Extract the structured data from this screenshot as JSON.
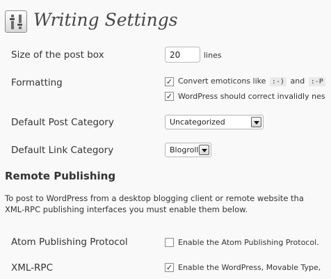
{
  "header": {
    "icon": "settings-sliders-icon",
    "title": "Writing Settings"
  },
  "post_box": {
    "label": "Size of the post box",
    "value": "20",
    "unit": "lines"
  },
  "formatting": {
    "label": "Formatting",
    "emoticons_prefix": "Convert emoticons like",
    "emoticon_1": ":-)",
    "and": "and",
    "emoticon_2": ":-P",
    "emoticons_checked": true,
    "xhtml_text": "WordPress should correct invalidly nes",
    "xhtml_checked": true
  },
  "default_post_category": {
    "label": "Default Post Category",
    "selected": "Uncategorized"
  },
  "default_link_category": {
    "label": "Default Link Category",
    "selected": "Blogroll"
  },
  "remote_publishing": {
    "heading": "Remote Publishing",
    "description_line1": "To post to WordPress from a desktop blogging client or remote website tha",
    "description_line2": "XML-RPC publishing interfaces you must enable them below.",
    "atom": {
      "label": "Atom Publishing Protocol",
      "text": "Enable the Atom Publishing Protocol.",
      "checked": false
    },
    "xmlrpc": {
      "label": "XML-RPC",
      "text": "Enable the WordPress, Movable Type,",
      "checked": true
    }
  }
}
